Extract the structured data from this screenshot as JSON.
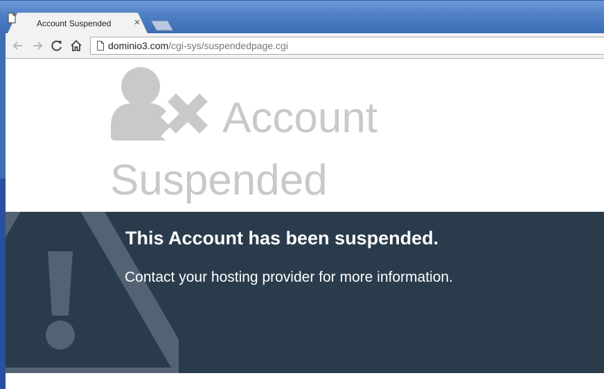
{
  "browser": {
    "tab": {
      "title": "Account Suspended",
      "close_glyph": "×",
      "icon": "file-icon"
    },
    "newtab_icon": "new-tab-icon",
    "nav": {
      "back_icon": "back-arrow-icon",
      "forward_icon": "forward-arrow-icon",
      "reload_icon": "reload-icon",
      "home_icon": "home-icon"
    },
    "address": {
      "host": "dominio3.com",
      "path": "/cgi-sys/suspendedpage.cgi",
      "icon": "page-info-icon"
    }
  },
  "page": {
    "hero": {
      "icon": "user-remove-icon",
      "title_line1": "Account",
      "title_line2": "Suspended",
      "color": "#c9c9c9"
    },
    "banner": {
      "icon": "warning-triangle-icon",
      "heading": "This Account has been suspended.",
      "text": "Contact your hosting provider for more information.",
      "background": "#2a3b4c"
    }
  }
}
